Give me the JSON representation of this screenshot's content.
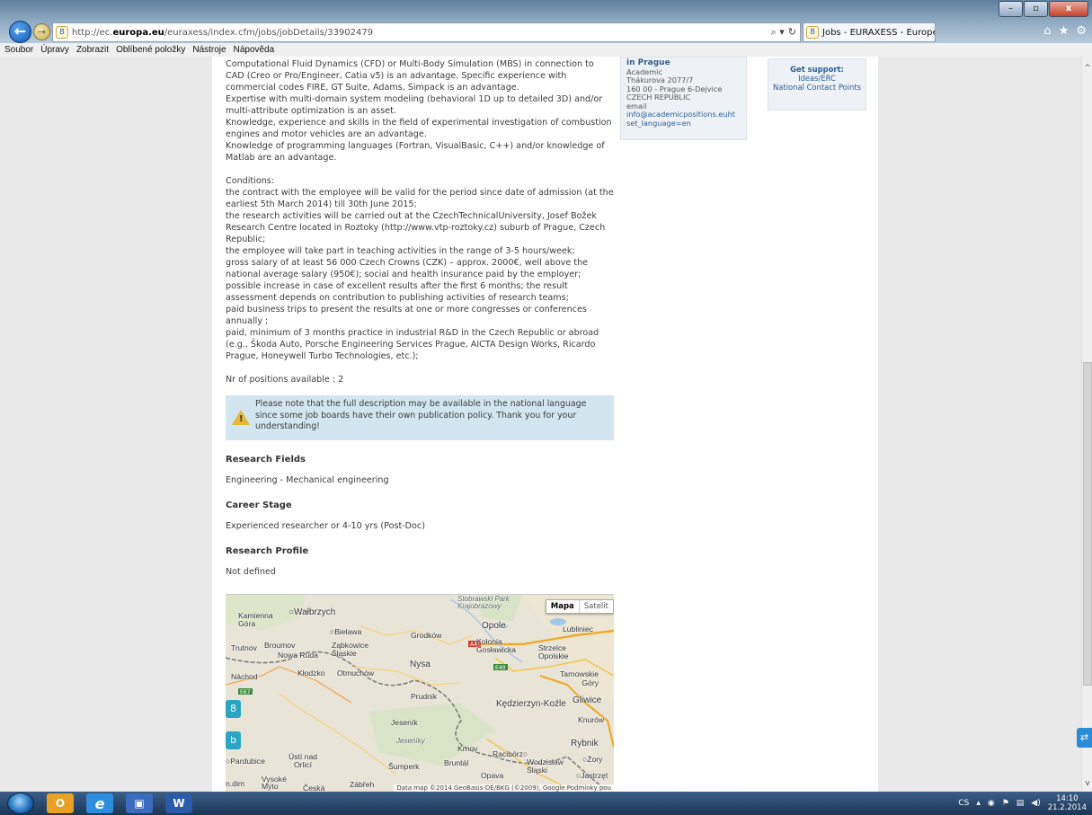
{
  "browser": {
    "url_prefix": "http://ec.",
    "url_domain": "europa.eu",
    "url_path": "/euraxess/index.cfm/jobs/jobDetails/33902479",
    "tab_title": "Jobs - EURAXESS - Europea...",
    "search_glyph": "⌕ ▾",
    "refresh_glyph": "↻",
    "tab_close": "✕",
    "home_icon": "⌂",
    "star_icon": "★",
    "settings_icon": "⚙"
  },
  "menu": [
    "Soubor",
    "Úpravy",
    "Zobrazit",
    "Oblíbené položky",
    "Nástroje",
    "Nápověda"
  ],
  "content": {
    "requirements_text": "Computational Fluid Dynamics (CFD) or Multi-Body Simulation (MBS) in connection to CAD (Creo or Pro/Engineer, Catia v5) is an advantage. Specific experience with commercial codes FIRE, GT Suite, Adams, Simpack is an advantage.\nExpertise with multi-domain system modeling (behavioral 1D up to detailed 3D) and/or multi-attribute optimization is an asset.\nKnowledge, experience and skills in the field of experimental investigation of combustion engines and motor vehicles are an advantage.\nKnowledge of programming languages (Fortran, VisualBasic, C++) and/or knowledge of Matlab are an advantage.",
    "conditions_heading": "Conditions:",
    "conditions_text": "the contract with the employee will be valid for the period since date of admission (at the earliest 5th March 2014) till 30th June 2015;\nthe research activities will be carried out at the CzechTechnicalUniversity, Josef Božek Research Centre located in Roztoky (http://www.vtp-roztoky.cz) suburb of  Prague, Czech Republic;\nthe employee will take part in teaching activities in the range of 3-5 hours/week;\ngross salary of at least 56 000 Czech Crowns (CZK) – approx. 2000€, well above the national average salary (950€); social and health insurance paid by the employer; possible increase in case of excellent results after the first 6 months; the result assessment depends on contribution to publishing activities of research teams;\npaid business trips to present the results at one or more congresses or conferences annually ;\npaid, minimum of  3 months practice in industrial R&D in the Czech Republic or abroad (e.g., Škoda Auto, Porsche Engineering Services Prague, AICTA Design Works, Ricardo Prague, Honeywell Turbo Technologies, etc.);",
    "positions": "Nr of positions available : 2",
    "note": "Please note that the full description may be available in the national language since some job boards have their own publication policy. Thank you for your understanding!",
    "research_fields_heading": "Research Fields",
    "research_fields_value": "Engineering - Mechanical engineering",
    "career_stage_heading": "Career Stage",
    "career_stage_value": "Experienced researcher or 4-10 yrs (Post-Doc)",
    "research_profile_heading": "Research Profile",
    "research_profile_value": "Not defined"
  },
  "contact": {
    "title": "in Prague",
    "type": "Academic",
    "street": "Thákurova 2077/7",
    "city": "160 00 - Prague 6-Dejvice",
    "country": "CZECH REPUBLIC",
    "email_label": "email",
    "email_value": "info@academicpositions.euht",
    "lang": "set_language=en"
  },
  "support": {
    "title": "Get support:",
    "link1": "Ideas/ERC",
    "link2": "National Contact Points"
  },
  "map": {
    "type_map": "Mapa",
    "type_satellite": "Satelit",
    "attribution": "Data map ©2014 GeoBasis-DE/BKG (©2009), Google   Podmínky pou",
    "labels": {
      "park": "Stobrawski Park\nKrajobrazowy",
      "walbrzych": "○Wałbrzych",
      "kamienna": "Kamienna\nGóra",
      "bielawa": "○Bielawa",
      "opole": "Opole",
      "lubliniec": "Lubliniec",
      "grodkow": "Grodków",
      "trutnov": "Trutnov",
      "broumov": "Broumov",
      "nowa_ruda": "Nowa Ruda",
      "zabkowice": "Ząbkowice\nŚląskie",
      "kolonia": "Kolonia\nGosławicka",
      "strzelce": "Strzelce\nOpolskie",
      "nysa": "Nysa",
      "nachod": "Náchod",
      "klodzko": "Kłodzko",
      "otmuchow": "Otmuchów",
      "tarnowskie": "Tarnowskie\nGóry",
      "prudnik": "Prudnik",
      "kedzierzyn": "Kędzierzyn-Koźle",
      "gliwice": "Gliwice",
      "jesenik": "Jeseník",
      "knurow": "Knurów",
      "jeseniky": "Jeseníky",
      "krnov": "Krnov",
      "rybnik": "Rybnik",
      "raciborz": "Racibórz○",
      "zory": "○Żory",
      "pardubice": "○Pardubice",
      "usti": "Ústí nad\nOrlicí",
      "sumperk": "Šumperk",
      "bruntal": "Bruntál",
      "wodzislaw": "Wodzisław\nŚląski",
      "opava": "Opava",
      "jastrzebie": "○Jastrzęt",
      "vysoke": "Vysoké\nMýto",
      "ceska": "Česká",
      "zabreh": "Zábřeh",
      "chrudim": "n.dim"
    },
    "road_labels": [
      "A4",
      "E40",
      "E67"
    ]
  },
  "taskbar": {
    "lang": "CS",
    "time": "14:10",
    "date": "21.2.2014"
  }
}
